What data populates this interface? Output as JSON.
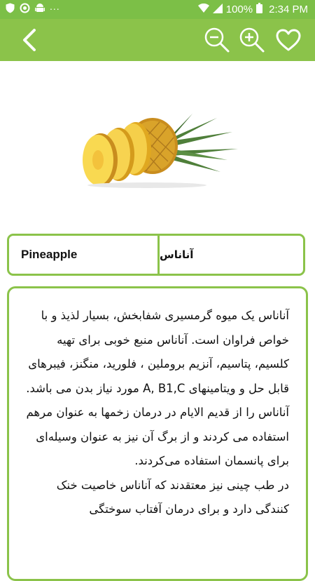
{
  "status_bar": {
    "battery": "100%",
    "time": "2:34 PM",
    "dots": "..."
  },
  "app_bar": {
    "back_icon": "chevron-left-icon",
    "zoom_out_icon": "zoom-out-icon",
    "zoom_in_icon": "zoom-in-icon",
    "favorite_icon": "heart-icon"
  },
  "item": {
    "name_en": "Pineapple",
    "name_fa": "آناناس",
    "description": "آناناس یک میوه گرمسیری شفابخش، بسیار لذیذ و با خواص فراوان است. آناناس منبع خوبی برای تهیه کلسیم، پتاسیم، آنزیم بروملین ، فلورید، منگنز، فیبرهای قابل حل و ویتامینهای A, B1,C مورد نیاز بدن می باشد.\nآناناس را از قدیم الایام در درمان زخمها به عنوان مرهم استفاده می کردند و از برگ آن نیز به عنوان وسیله‌ای برای پانسمان استفاده می‌کردند.\nدر طب چینی نیز معتقدند که آناناس خاصیت خنک کنندگی دارد و برای درمان آفتاب سوختگی"
  },
  "colors": {
    "status_bar": "#7cbf47",
    "app_bar": "#8bc34a",
    "border": "#8bc34a"
  }
}
